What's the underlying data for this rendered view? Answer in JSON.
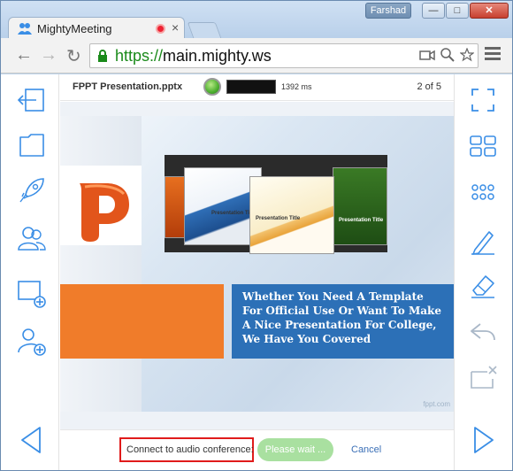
{
  "browser": {
    "tab_title": "MightyMeeting",
    "tab_close": "×",
    "user_badge": "Farshad",
    "window_buttons": {
      "minimize": "—",
      "maximize": "□",
      "close": "✕"
    },
    "url_scheme": "https://",
    "url_host": "main.mighty.ws",
    "nav": {
      "back": "←",
      "forward": "→",
      "reload": "↻"
    },
    "omnibox_icons": [
      "camera-icon",
      "zoom-icon",
      "star-icon"
    ],
    "menu_icon": "hamburger-menu-icon"
  },
  "meeting": {
    "file_name": "FPPT Presentation.pptx",
    "latency": "1392 ms",
    "page_indicator": "2 of 5",
    "status_color": "#4caf2e"
  },
  "slide": {
    "thumb_title_a": "Presentation Title",
    "thumb_title_b": "Presentation Title",
    "thumb_title_c": "Presentation Title",
    "headline_1": "Whether You Need A Template",
    "headline_2": "For Official Use Or Want To Make",
    "headline_3": "A Nice Presentation For College,",
    "headline_4": "We Have You Covered",
    "watermark": "fppt.com"
  },
  "left_sidebar": {
    "icons": [
      "exit-icon",
      "folder-icon",
      "rocket-icon",
      "contacts-icon",
      "add-screen-icon",
      "add-user-icon",
      "previous-slide-icon"
    ]
  },
  "right_sidebar": {
    "icons": [
      "fullscreen-icon",
      "grid-large-icon",
      "grid-small-icon",
      "pen-icon",
      "eraser-icon",
      "undo-icon",
      "clear-icon",
      "next-slide-icon"
    ]
  },
  "audio": {
    "prompt": "Connect to audio conference:",
    "wait_label": "Please wait ...",
    "cancel_label": "Cancel"
  },
  "colors": {
    "accent_blue": "#3a8ee6",
    "slide_blue": "#2c70b7",
    "slide_orange": "#f07c2a",
    "alert_red": "#e01b1b"
  }
}
